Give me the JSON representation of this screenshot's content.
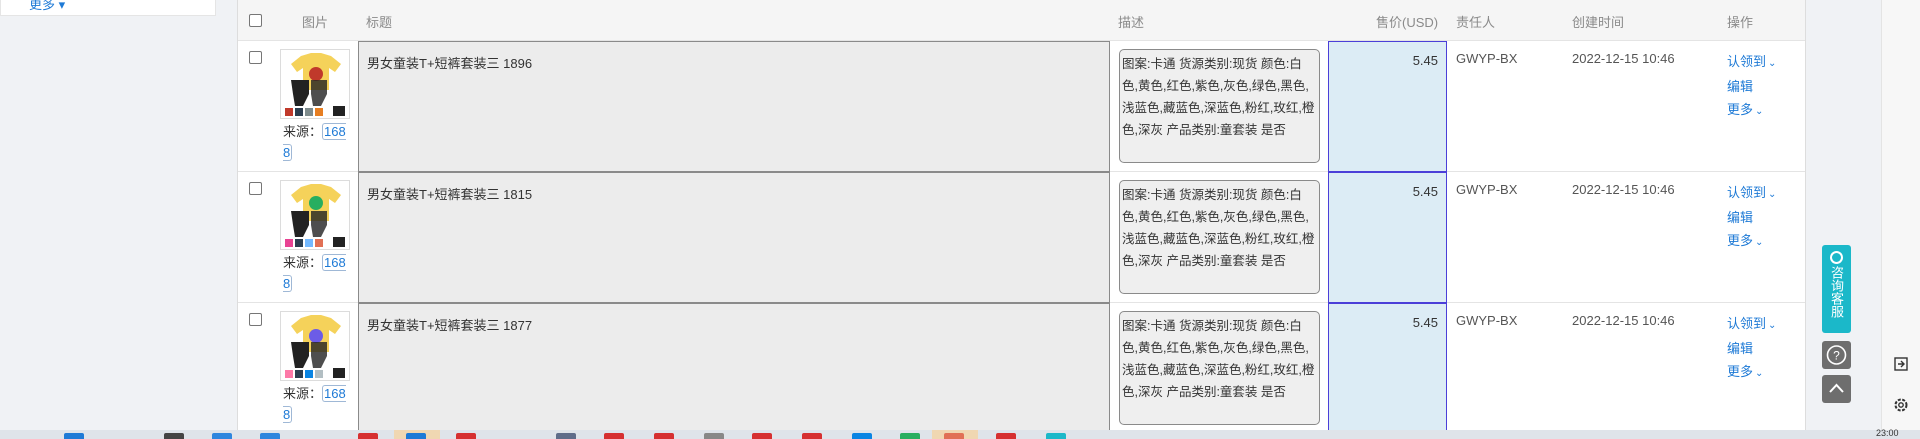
{
  "sidebar": {
    "more_link": "更多 ▾"
  },
  "table": {
    "headers": {
      "image": "图片",
      "title": "标题",
      "description": "描述",
      "price": "售价(USD)",
      "owner": "责任人",
      "created": "创建时间",
      "actions": "操作"
    },
    "rows": [
      {
        "title": "男女童装T+短裤套装三 1896",
        "source_label": "来源：",
        "source_code": "1688",
        "description": "图案:卡通 货源类别:现货 颜色:白色,黄色,红色,紫色,灰色,绿色,黑色,浅蓝色,藏蓝色,深蓝色,粉红,玫红,橙色,深灰 产品类别:童套装 是否",
        "price": "5.45",
        "owner": "GWYP-BX",
        "created": "2022-12-15 10:46",
        "action_claim": "认领到",
        "action_edit": "编辑",
        "action_more": "更多"
      },
      {
        "title": "男女童装T+短裤套装三 1815",
        "source_label": "来源：",
        "source_code": "1688",
        "description": "图案:卡通 货源类别:现货 颜色:白色,黄色,红色,紫色,灰色,绿色,黑色,浅蓝色,藏蓝色,深蓝色,粉红,玫红,橙色,深灰 产品类别:童套装 是否",
        "price": "5.45",
        "owner": "GWYP-BX",
        "created": "2022-12-15 10:46",
        "action_claim": "认领到",
        "action_edit": "编辑",
        "action_more": "更多"
      },
      {
        "title": "男女童装T+短裤套装三 1877",
        "source_label": "来源：",
        "source_code": "1688",
        "description": "图案:卡通 货源类别:现货 颜色:白色,黄色,红色,紫色,灰色,绿色,黑色,浅蓝色,藏蓝色,深蓝色,粉红,玫红,橙色,深灰 产品类别:童套装 是否",
        "price": "5.45",
        "owner": "GWYP-BX",
        "created": "2022-12-15 10:46",
        "action_claim": "认领到",
        "action_edit": "编辑",
        "action_more": "更多"
      }
    ]
  },
  "float_panel": {
    "service_label": "咨询客服",
    "help_icon": "question-icon",
    "top_icon": "arrow-up-icon"
  },
  "right_rail": {
    "icons": [
      "exit-window-icon",
      "gear-icon"
    ]
  },
  "taskbar": {
    "clock": "23:00"
  },
  "colors": {
    "link": "#1e7ad6",
    "service": "#1bb8c9",
    "price_bg": "#dcecf5",
    "price_border": "#4b3fd8"
  }
}
